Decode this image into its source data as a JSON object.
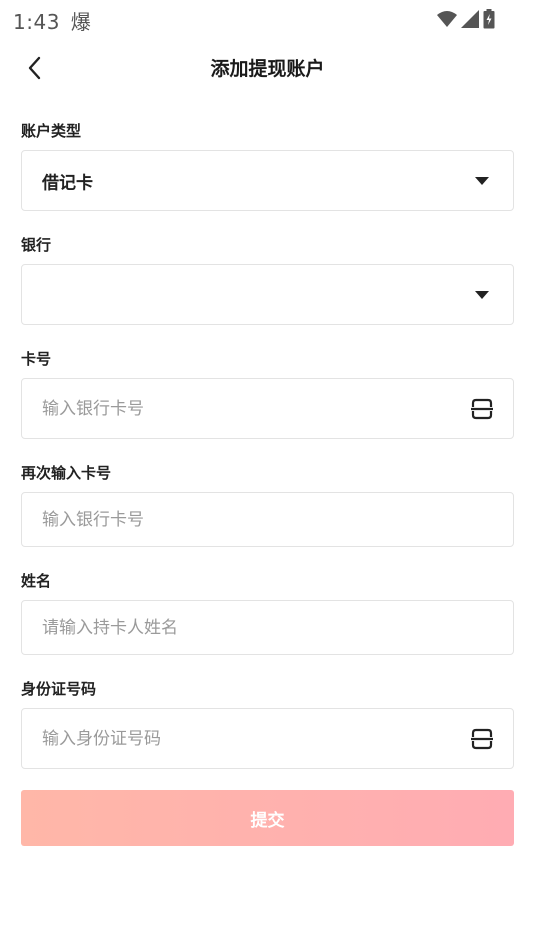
{
  "status_bar": {
    "time": "1:43",
    "notification_glyph": "爆"
  },
  "header": {
    "title": "添加提现账户"
  },
  "form": {
    "account_type": {
      "label": "账户类型",
      "value": "借记卡"
    },
    "bank": {
      "label": "银行",
      "value": ""
    },
    "card_number": {
      "label": "卡号",
      "placeholder": "输入银行卡号"
    },
    "card_number_confirm": {
      "label": "再次输入卡号",
      "placeholder": "输入银行卡号"
    },
    "name": {
      "label": "姓名",
      "placeholder": "请输入持卡人姓名"
    },
    "id_number": {
      "label": "身份证号码",
      "placeholder": "输入身份证号码"
    }
  },
  "submit": {
    "label": "提交"
  },
  "colors": {
    "submit_gradient_start": "#ffb7a8",
    "submit_gradient_end": "#ffacb3",
    "border": "#e3e3e3",
    "placeholder": "#9a9a9a"
  }
}
